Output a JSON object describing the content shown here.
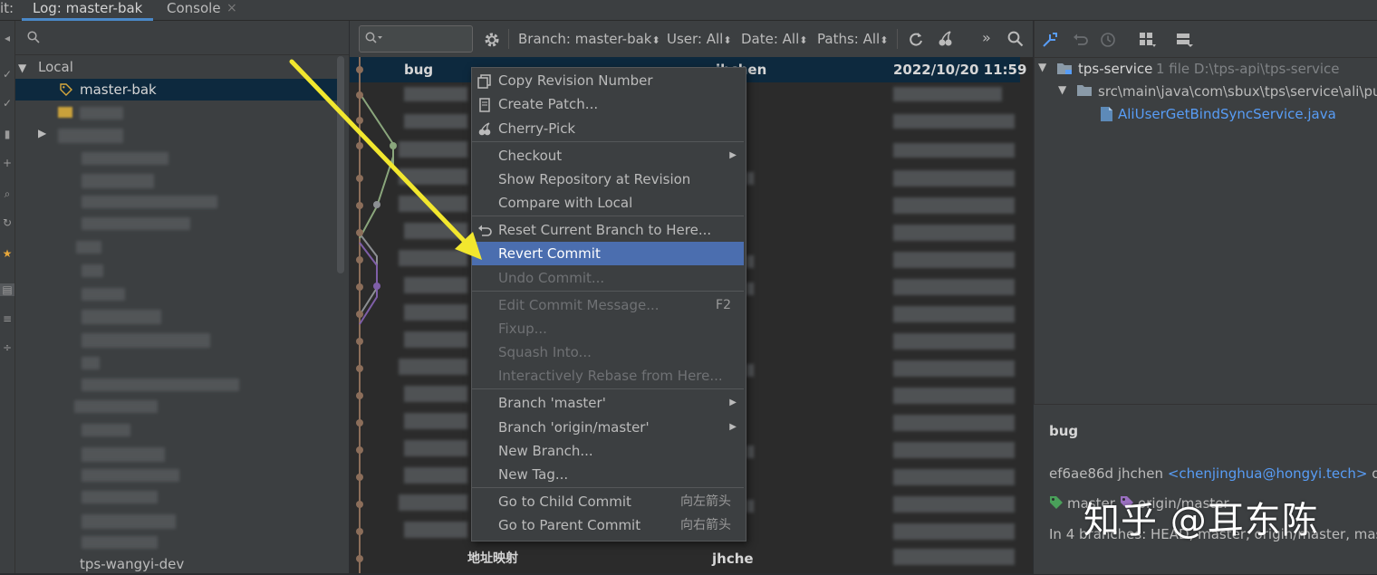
{
  "tabs": {
    "prefix": "it:",
    "log_tab": "Log: master-bak",
    "console_tab": "Console",
    "close_glyph": "×"
  },
  "branches": {
    "local_label": "Local",
    "current_branch": "master-bak",
    "last_visible_branch": "tps-wangyi-dev"
  },
  "log_toolbar": {
    "branch_filter": "Branch: master-bak",
    "user_filter": "User: All",
    "date_filter": "Date: All",
    "paths_filter": "Paths: All",
    "dropdown_glyph": "⬍"
  },
  "log_rows": {
    "selected": {
      "subject": "bug",
      "author": "jhchen",
      "date": "2022/10/20 11:59"
    },
    "bottom": {
      "subject": "地址映射",
      "author": "jhche"
    }
  },
  "context_menu": {
    "items": [
      {
        "label": "Copy Revision Number",
        "enabled": true,
        "icon": "copy-icon"
      },
      {
        "label": "Create Patch...",
        "enabled": true,
        "icon": "patch-icon"
      },
      {
        "label": "Cherry-Pick",
        "enabled": true,
        "icon": "cherry-icon"
      },
      {
        "label": "Checkout",
        "enabled": true,
        "submenu": true
      },
      {
        "label": "Show Repository at Revision",
        "enabled": true
      },
      {
        "label": "Compare with Local",
        "enabled": true
      },
      {
        "label": "Reset Current Branch to Here...",
        "enabled": true,
        "icon": "reset-icon"
      },
      {
        "label": "Revert Commit",
        "enabled": true,
        "highlighted": true
      },
      {
        "label": "Undo Commit...",
        "enabled": false
      },
      {
        "label": "Edit Commit Message...",
        "enabled": false,
        "shortcut": "F2"
      },
      {
        "label": "Fixup...",
        "enabled": false
      },
      {
        "label": "Squash Into...",
        "enabled": false
      },
      {
        "label": "Interactively Rebase from Here...",
        "enabled": false
      },
      {
        "label": "Branch 'master'",
        "enabled": true,
        "submenu": true
      },
      {
        "label": "Branch 'origin/master'",
        "enabled": true,
        "submenu": true
      },
      {
        "label": "New Branch...",
        "enabled": true
      },
      {
        "label": "New Tag...",
        "enabled": true
      },
      {
        "label": "Go to Child Commit",
        "enabled": true,
        "shortcut": "向左箭头"
      },
      {
        "label": "Go to Parent Commit",
        "enabled": true,
        "shortcut": "向右箭头"
      }
    ]
  },
  "changed_files": {
    "module": "tps-service",
    "module_meta": "1 file  D:\\tps-api\\tps-service",
    "folder": "src\\main\\java\\com\\sbux\\tps\\service\\ali\\pu",
    "file": "AliUserGetBindSyncService.java"
  },
  "commit_details": {
    "message": "bug",
    "hash": "ef6ae86d",
    "author": "jhchen",
    "email": "<chenjinghua@hongyi.tech>",
    "on_text": "on",
    "ref_local": "master",
    "ref_remote": "origin/master",
    "branches_line": "In 4 branches: HEAD, master, origin/master, maste"
  },
  "watermark": "知乎 @耳东陈",
  "colors": {
    "selection_row": "#0d293e",
    "menu_highlight": "#4b6eaf",
    "accent_link": "#589df6",
    "arrow_yellow": "#f2e72e"
  }
}
